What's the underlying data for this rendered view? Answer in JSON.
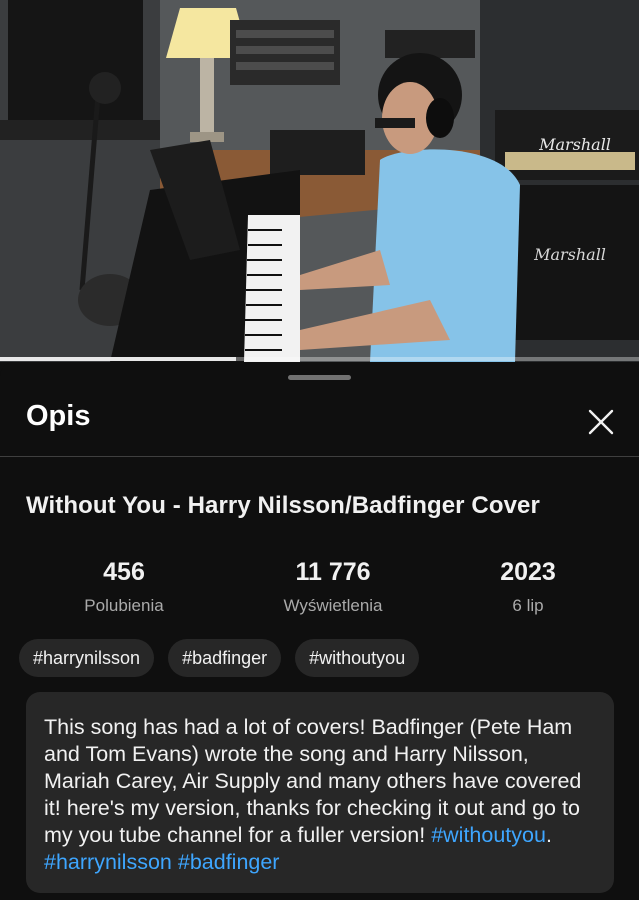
{
  "video": {
    "progress_fraction": 0.37,
    "amp_brand": "Marshall"
  },
  "sheet": {
    "title": "Opis",
    "close_label": "×"
  },
  "details": {
    "title": "Without You - Harry Nilsson/Badfinger Cover",
    "stats": [
      {
        "value": "456",
        "label": "Polubienia"
      },
      {
        "value": "11 776",
        "label": "Wyświetlenia"
      },
      {
        "value": "2023",
        "label": "6 lip"
      }
    ],
    "hashtags": [
      "#harrynilsson",
      "#badfinger",
      "#withoutyou"
    ]
  },
  "description": {
    "text": "This song has had a lot of covers! Badfinger (Pete Ham and Tom Evans) wrote the song and Harry Nilsson, Mariah Carey, Air Supply and many others have covered it! here's my version, thanks for checking it out and go to my you tube channel for a fuller version!  ",
    "tag1": "#withoutyou",
    "separator": ".",
    "tag2": "#harrynilsson",
    "tag3": "#badfinger"
  },
  "colors": {
    "background": "#0f0f0f",
    "surface": "#272727",
    "link": "#3ea6ff",
    "secondary_text": "#aaaaaa"
  }
}
